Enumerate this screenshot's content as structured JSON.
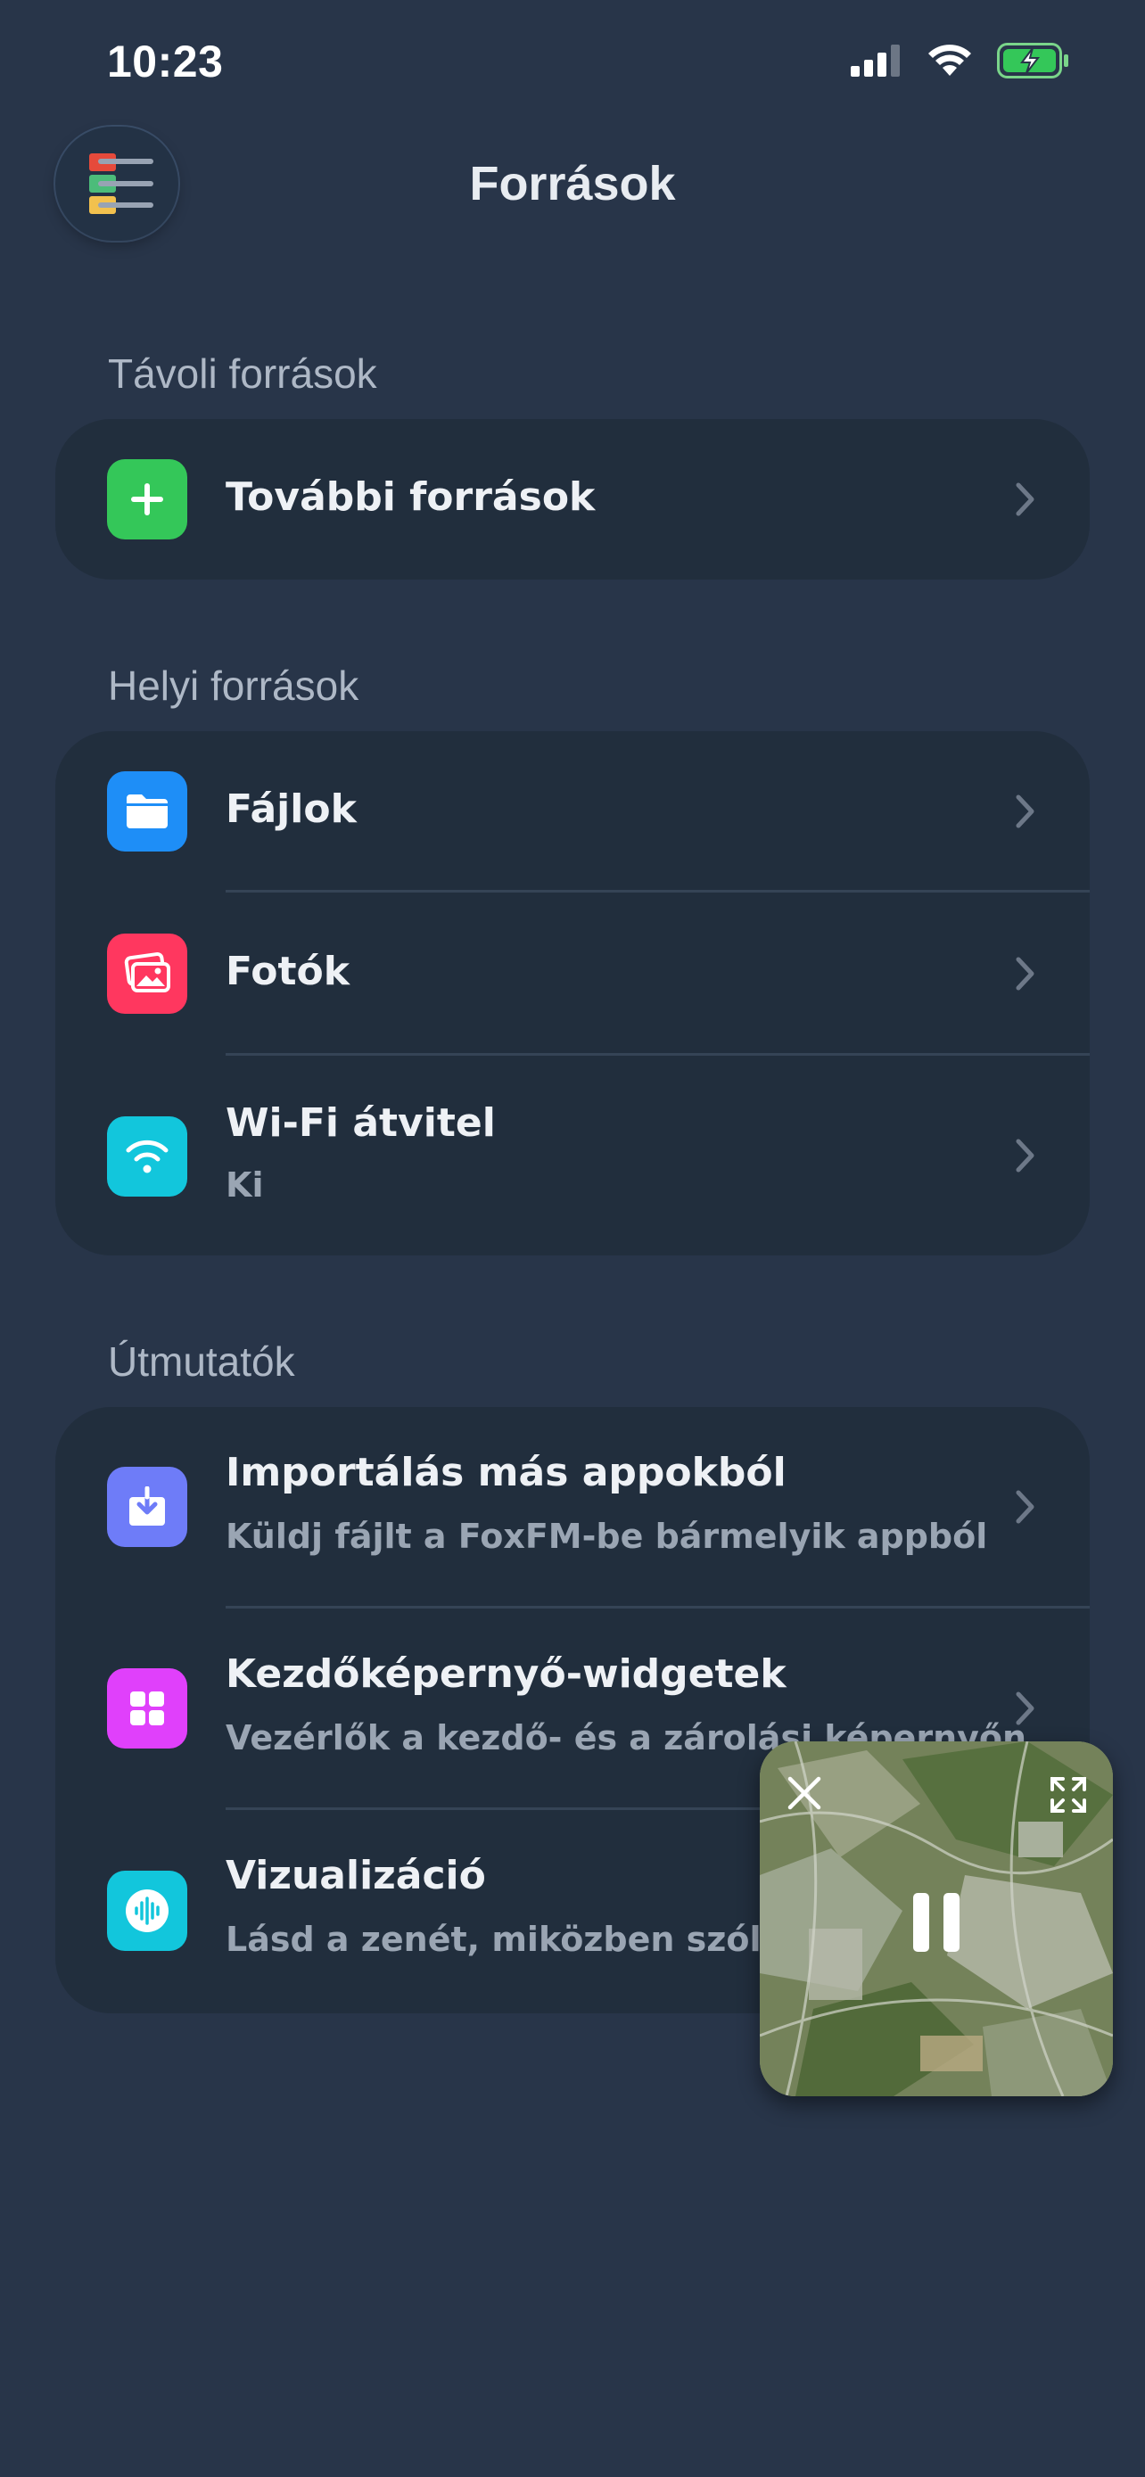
{
  "status_bar": {
    "time": "10:23"
  },
  "header": {
    "title": "Források"
  },
  "sections": {
    "remote": {
      "title": "Távoli források",
      "items": [
        {
          "label": "További források",
          "icon": "plus-icon",
          "color": "#34c759"
        }
      ]
    },
    "local": {
      "title": "Helyi források",
      "items": [
        {
          "label": "Fájlok",
          "icon": "folder-icon",
          "color": "#1e8ef7"
        },
        {
          "label": "Fotók",
          "icon": "photos-icon",
          "color": "#ff375f"
        },
        {
          "label": "Wi-Fi átvitel",
          "sublabel": "Ki",
          "icon": "wifi-icon",
          "color": "#12c6dc"
        }
      ]
    },
    "guides": {
      "title": "Útmutatók",
      "items": [
        {
          "label": "Importálás más appokból",
          "sublabel": "Küldj fájlt a FoxFM-be bármelyik appból",
          "icon": "import-icon",
          "color": "#6e7cf8"
        },
        {
          "label": "Kezdőképernyő-widgetek",
          "sublabel": "Vezérlők a kezdő- és a zárolási képernyőn",
          "icon": "widgets-icon",
          "color": "#e040fb"
        },
        {
          "label": "Vizualizáció",
          "sublabel": "Lásd a zenét, miközben szól —",
          "icon": "waveform-icon",
          "color": "#12c6dc"
        }
      ]
    }
  },
  "colors": {
    "background": "#283549",
    "card": "#212e3d",
    "accent_green": "#34c759"
  }
}
